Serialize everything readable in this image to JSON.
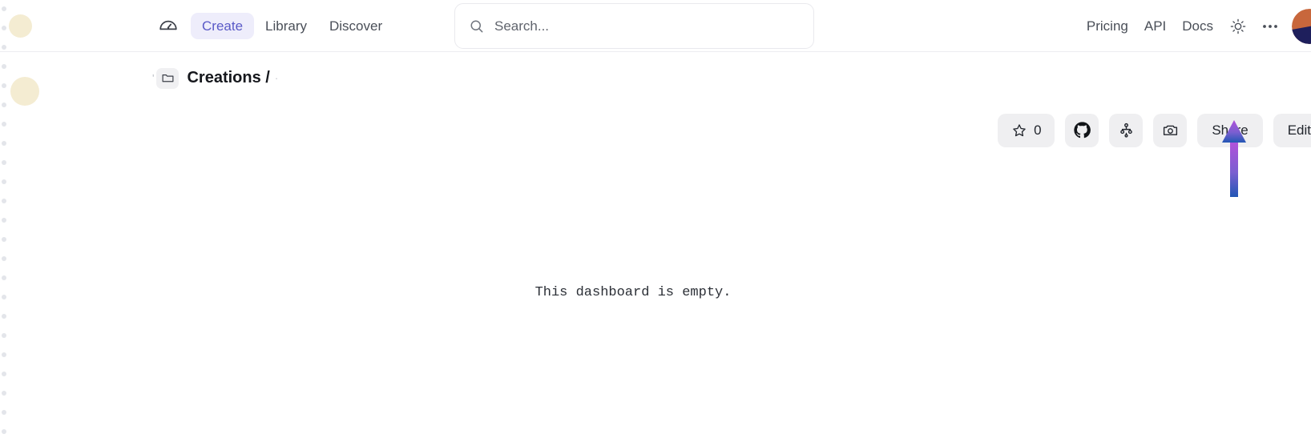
{
  "topnav": {
    "logo_icon": "gauge-icon",
    "links": [
      {
        "label": "Create",
        "active": true
      },
      {
        "label": "Library",
        "active": false
      },
      {
        "label": "Discover",
        "active": false
      }
    ],
    "search": {
      "icon": "search-icon",
      "value": "",
      "placeholder": "Search..."
    },
    "right_links": [
      {
        "label": "Pricing"
      },
      {
        "label": "API"
      },
      {
        "label": "Docs"
      }
    ],
    "theme_icon": "sun-icon",
    "overflow_icon": "ellipsis-icon",
    "avatar": {
      "name": "user-avatar",
      "top_color": "#c8673c",
      "bottom_color": "#1e1f5c"
    }
  },
  "subheader": {
    "breadcrumb": {
      "leading_mark": "'",
      "folder_icon": "folder-icon",
      "name": "Creations /",
      "trailing_mark": "·"
    },
    "actions": {
      "star": {
        "icon": "star-icon",
        "count": "0"
      },
      "github": {
        "icon": "github-icon"
      },
      "fork": {
        "icon": "git-fork-icon"
      },
      "screenshot": {
        "icon": "camera-icon"
      },
      "share": {
        "label": "Share"
      },
      "edit": {
        "label": "Edit"
      }
    }
  },
  "main": {
    "empty_message": "This dashboard is empty."
  },
  "annotation": {
    "arrow": {
      "name": "pointer-arrow",
      "direction": "up",
      "color_top": "#b152da",
      "color_bottom": "#2257b5"
    }
  },
  "decor": {
    "rail_dot_color": "#e3e5ea",
    "blob_color": "#f4ecd2"
  }
}
